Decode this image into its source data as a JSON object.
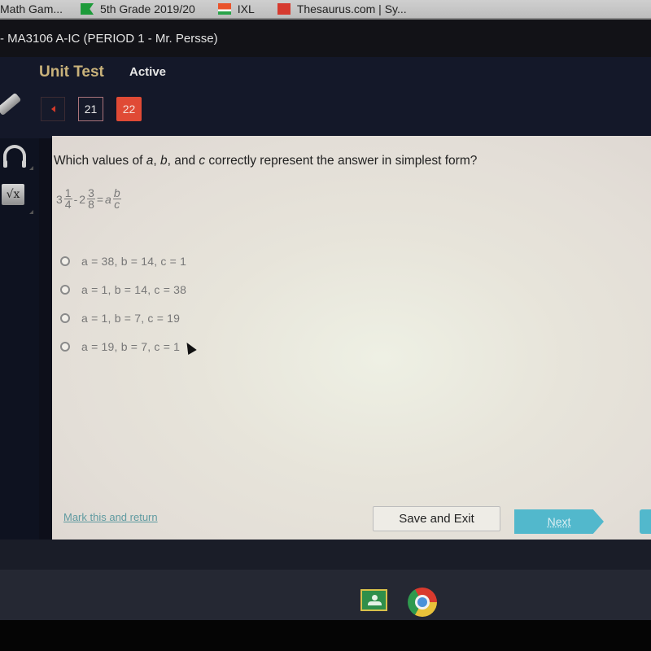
{
  "bookmarks": [
    {
      "label": "Math Gam...",
      "icon": "bookmark-icon"
    },
    {
      "label": "5th Grade 2019/20",
      "icon": "flag-icon"
    },
    {
      "label": "IXL",
      "icon": "ixl-icon"
    },
    {
      "label": "Thesaurus.com | Sy...",
      "icon": "thesaurus-icon"
    }
  ],
  "course": {
    "title": "- MA3106 A-IC (PERIOD 1 - Mr. Persse)"
  },
  "header": {
    "activity": "Unit Test",
    "status": "Active",
    "questions": [
      {
        "number": "21",
        "current": false
      },
      {
        "number": "22",
        "current": true
      }
    ],
    "colors": {
      "current_question": "#e04a35",
      "activity_title": "#c9b27a"
    }
  },
  "tools": [
    "pencil-icon",
    "headphones-icon",
    "sqrt-calculator-icon"
  ],
  "question": {
    "prefix": "Which values of ",
    "var_a": "a",
    "sep1": ", ",
    "var_b": "b",
    "sep2": ", and ",
    "var_c": "c",
    "suffix": " correctly represent the answer in simplest form?",
    "equation": {
      "term1_whole": "3",
      "term1_num": "1",
      "term1_den": "4",
      "operator": "-",
      "term2_whole": "2",
      "term2_num": "3",
      "term2_den": "8",
      "equals": "=",
      "result_whole": "a",
      "result_num": "b",
      "result_den": "c"
    },
    "options": [
      {
        "label": "a = 38, b = 14, c = 1",
        "selected": false
      },
      {
        "label": "a = 1, b = 14, c = 38",
        "selected": false
      },
      {
        "label": "a = 1, b = 7, c = 19",
        "selected": false
      },
      {
        "label": "a = 19, b = 7, c = 1",
        "selected": false
      }
    ]
  },
  "footer": {
    "mark_link": "Mark this and return",
    "save_exit": "Save and Exit",
    "next": "Next",
    "colors": {
      "next": "#52b8cc"
    }
  },
  "shelf": {
    "apps": [
      "google-classroom-icon",
      "chrome-icon"
    ]
  }
}
